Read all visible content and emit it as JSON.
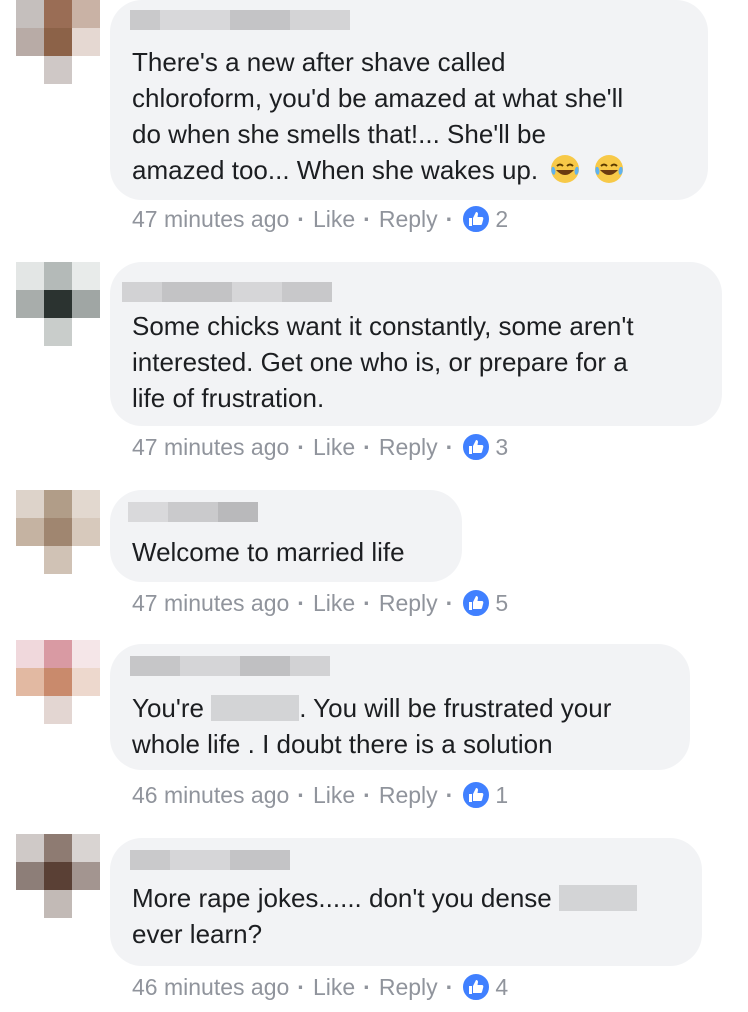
{
  "comments": [
    {
      "lines": [
        "There's a new after shave called",
        "chloroform, you'd be amazed at what she'll",
        "do when she smells that!... She'll be",
        "amazed too... When she wakes up."
      ],
      "emoji_after_last_line": [
        "laughing-tears-icon",
        "laughing-tears-icon"
      ],
      "time": "47 minutes ago",
      "like_label": "Like",
      "reply_label": "Reply",
      "likes": "2"
    },
    {
      "lines": [
        "Some chicks want it constantly, some aren't",
        "interested. Get one who is, or prepare for a",
        "life of frustration."
      ],
      "time": "47 minutes ago",
      "like_label": "Like",
      "reply_label": "Reply",
      "likes": "3"
    },
    {
      "lines": [
        "Welcome to married life"
      ],
      "time": "47 minutes ago",
      "like_label": "Like",
      "reply_label": "Reply",
      "likes": "5"
    },
    {
      "line1_before": "You're",
      "line1_after": ". You will be frustrated your",
      "line2": "whole life . I doubt there is a solution",
      "time": "46 minutes ago",
      "like_label": "Like",
      "reply_label": "Reply",
      "likes": "1"
    },
    {
      "line1_before": "More rape jokes...... don't you dense",
      "line2": "ever learn?",
      "time": "46 minutes ago",
      "like_label": "Like",
      "reply_label": "Reply",
      "likes": "4"
    }
  ],
  "colors": {
    "bubble": "#f2f3f5",
    "meta_text": "#90949c",
    "like_badge": "#4080ff",
    "redaction": "#d3d4d6"
  }
}
